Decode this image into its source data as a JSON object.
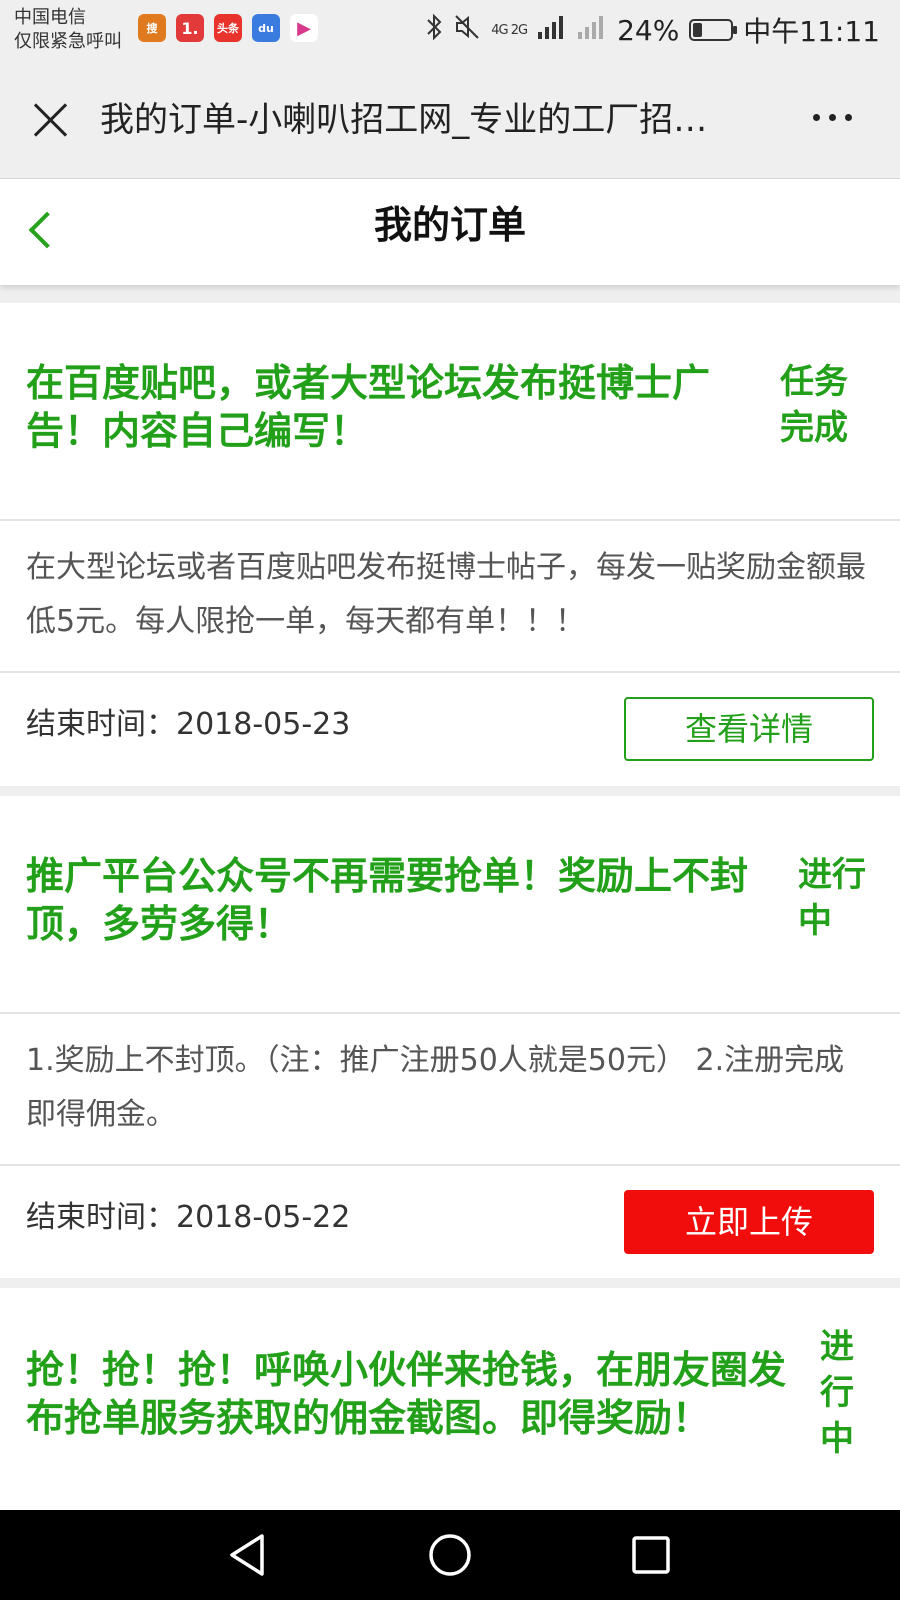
{
  "status_bar": {
    "carrier_line1": "中国电信",
    "carrier_line2": "仅限紧急呼叫",
    "battery_percent": "24%",
    "battery_level": 0.24,
    "time": "中午11:11",
    "network": "4G 2G",
    "app_icons": [
      {
        "icon": "sogou-app-icon",
        "label": "搜",
        "color": "#e07a1f"
      },
      {
        "icon": "yihaodian-app-icon",
        "label": "1.",
        "color": "#e23a3a"
      },
      {
        "icon": "toutiao-app-icon",
        "label": "头条",
        "color": "#e8322c"
      },
      {
        "icon": "baidu-app-icon",
        "label": "du",
        "color": "#3a7be0"
      },
      {
        "icon": "video-app-icon",
        "label": "▶",
        "color": "#ffffff"
      }
    ]
  },
  "browser": {
    "title": "我的订单-小喇叭招工网_专业的工厂招…"
  },
  "header": {
    "title": "我的订单"
  },
  "orders": [
    {
      "title": "在百度贴吧，或者大型论坛发布挺博士广告！内容自己编写！",
      "status": "任务完成",
      "description": "在大型论坛或者百度贴吧发布挺博士帖子，每发一贴奖励金额最低5元。每人限抢一单，每天都有单！！！",
      "end_time": "结束时间：2018-05-23",
      "button": "查看详情"
    },
    {
      "title": "推广平台公众号不再需要抢单！奖励上不封顶，多劳多得！",
      "status": "进行中",
      "description": "1.奖励上不封顶。（注：推广注册50人就是50元） 2.注册完成即得佣金。",
      "end_time": "结束时间：2018-05-22",
      "button": "立即上传"
    },
    {
      "title": "抢！抢！抢！呼唤小伙伴来抢钱，在朋友圈发布抢单服务获取的佣金截图。即得奖励！",
      "status": "进行中"
    }
  ],
  "colors": {
    "accent_green": "#23a01a",
    "upload_red": "#f20d0d"
  }
}
